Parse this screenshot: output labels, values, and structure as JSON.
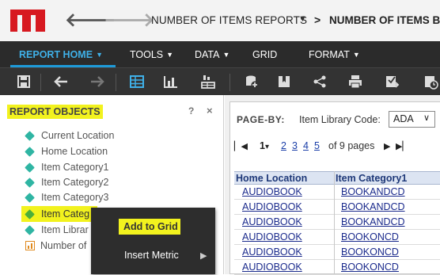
{
  "header": {
    "breadcrumb_1": "NUMBER OF ITEMS REPORTS",
    "breadcrumb_separator": ">",
    "breadcrumb_2": "NUMBER OF ITEMS B",
    "logo_color": "#d71920"
  },
  "menubar": {
    "items": [
      {
        "label": "REPORT HOME",
        "has_caret": true,
        "active": true
      },
      {
        "label": "TOOLS",
        "has_caret": true
      },
      {
        "label": "DATA",
        "has_caret": true
      },
      {
        "label": "GRID",
        "has_caret": false
      },
      {
        "label": "FORMAT",
        "has_caret": true
      }
    ],
    "accent_color": "#1e9ad8"
  },
  "toolbar": {
    "icons": [
      "save-icon",
      "undo-icon",
      "redo-icon",
      "grid-view-icon",
      "graph-view-icon",
      "grid-graph-view-icon",
      "add-data-icon",
      "bookmark-icon",
      "share-icon",
      "print-icon",
      "export-icon",
      "schedule-icon"
    ]
  },
  "report_objects": {
    "title": "REPORT OBJECTS",
    "help_label": "?",
    "close_label": "×",
    "items": [
      {
        "label": "Current Location",
        "type": "attribute"
      },
      {
        "label": "Home Location",
        "type": "attribute"
      },
      {
        "label": "Item Category1",
        "type": "attribute"
      },
      {
        "label": "Item Category2",
        "type": "attribute"
      },
      {
        "label": "Item Category3",
        "type": "attribute"
      },
      {
        "label": "Item Categ",
        "type": "attribute",
        "selected": true
      },
      {
        "label": "Item Librar",
        "type": "attribute"
      },
      {
        "label": "Number of",
        "type": "metric"
      }
    ],
    "highlight_color": "#f2f21e"
  },
  "context_menu": {
    "add_to_grid": "Add to Grid",
    "insert_metric": "Insert Metric",
    "submenu_arrow": "▶"
  },
  "page_by": {
    "label": "PAGE-BY:",
    "field": "Item Library Code:",
    "selected": "ADA",
    "chevron": "∨"
  },
  "pager": {
    "current": "1",
    "current_caret": "▾",
    "pages": [
      "2",
      "3",
      "4",
      "5"
    ],
    "summary": "of 9 pages"
  },
  "grid": {
    "columns": [
      "Home Location",
      "Item Category1"
    ],
    "rows": [
      [
        "AUDIOBOOK",
        "BOOKANDCD"
      ],
      [
        "AUDIOBOOK",
        "BOOKANDCD"
      ],
      [
        "AUDIOBOOK",
        "BOOKANDCD"
      ],
      [
        "AUDIOBOOK",
        "BOOKONCD"
      ],
      [
        "AUDIOBOOK",
        "BOOKONCD"
      ],
      [
        "AUDIOBOOK",
        "BOOKONCD"
      ]
    ]
  }
}
